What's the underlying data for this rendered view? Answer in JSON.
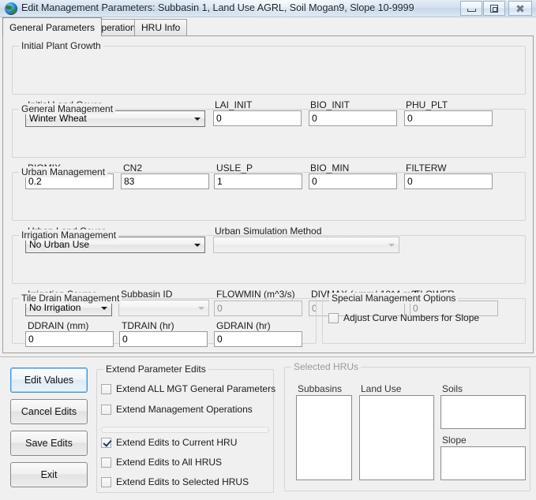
{
  "window": {
    "title": "Edit Management Parameters: Subbasin 1, Land Use AGRL, Soil Mogan9, Slope 10-9999",
    "app_icon": "globe-icon",
    "minimize_label": "Minimize",
    "maximize_label": "Restore",
    "close_label": "Close"
  },
  "tabs": [
    {
      "label": "General Parameters",
      "active": true
    },
    {
      "label": "Operations",
      "active": false
    },
    {
      "label": "HRU Info",
      "active": false
    }
  ],
  "groups": {
    "initial_plant_growth": {
      "legend": "Initial Plant Growth",
      "fields": {
        "initial_land_cover": {
          "label": "Initial Land Cover",
          "value": "Winter Wheat"
        },
        "lai_init": {
          "label": "LAI_INIT",
          "value": "0"
        },
        "bio_init": {
          "label": "BIO_INIT",
          "value": "0"
        },
        "phu_plt": {
          "label": "PHU_PLT",
          "value": "0"
        }
      }
    },
    "general_management": {
      "legend": "General Management",
      "fields": {
        "biomix": {
          "label": "BIOMIX",
          "value": "0.2"
        },
        "cn2": {
          "label": "CN2",
          "value": "83"
        },
        "usle_p": {
          "label": "USLE_P",
          "value": "1"
        },
        "bio_min": {
          "label": "BIO_MIN",
          "value": "0"
        },
        "filterw": {
          "label": "FILTERW",
          "value": "0"
        }
      }
    },
    "urban_management": {
      "legend": "Urban Management",
      "fields": {
        "urban_land_cover": {
          "label": "Urban Land Cover",
          "value": "No Urban Use"
        },
        "urban_simulation_method": {
          "label": "Urban Simulation Method",
          "value": ""
        }
      }
    },
    "irrigation_management": {
      "legend": "Irrigation Management",
      "fields": {
        "irrigation_source": {
          "label": "Irrigation Source",
          "value": "No Irrigation"
        },
        "subbasin_id": {
          "label": "Subbasin ID",
          "value": ""
        },
        "flowmin": {
          "label": "FLOWMIN (m^3/s)",
          "value": "0"
        },
        "divmax": {
          "label": "DIVMAX (+mm/-10^4 m3)",
          "value": "0"
        },
        "flowfr": {
          "label": "FLOWFR",
          "value": "0"
        }
      }
    },
    "tile_drain_management": {
      "legend": "Tile Drain Management",
      "fields": {
        "ddrain": {
          "label": "DDRAIN (mm)",
          "value": "0"
        },
        "tdrain": {
          "label": "TDRAIN (hr)",
          "value": "0"
        },
        "gdrain": {
          "label": "GDRAIN (hr)",
          "value": "0"
        }
      }
    },
    "special_management_options": {
      "legend": "Special Management Options",
      "checkbox": {
        "label": "Adjust Curve Numbers for Slope",
        "checked": false
      }
    },
    "extend_parameter_edits": {
      "legend": "Extend Parameter Edits",
      "checkboxes": [
        {
          "label": "Extend ALL MGT General Parameters",
          "checked": false
        },
        {
          "label": "Extend Management Operations",
          "checked": false
        },
        {
          "label": "Extend Edits to Current HRU",
          "checked": true
        },
        {
          "label": "Extend Edits to All HRUS",
          "checked": false
        },
        {
          "label": "Extend Edits to Selected HRUS",
          "checked": false
        }
      ]
    },
    "selected_hrus": {
      "legend": "Selected HRUs",
      "lists": [
        {
          "label": "Subbasins",
          "items": []
        },
        {
          "label": "Land Use",
          "items": []
        },
        {
          "label": "Soils",
          "items": []
        },
        {
          "label": "Slope",
          "items": []
        }
      ]
    }
  },
  "buttons": {
    "edit_values": "Edit Values",
    "cancel_edits": "Cancel Edits",
    "save_edits": "Save Edits",
    "exit": "Exit"
  },
  "colors": {
    "window_bg": "#f0f0f0",
    "focus_blue": "#3d95d6",
    "group_border": "#d4d4d4",
    "disabled_text": "#8a8a8a"
  }
}
